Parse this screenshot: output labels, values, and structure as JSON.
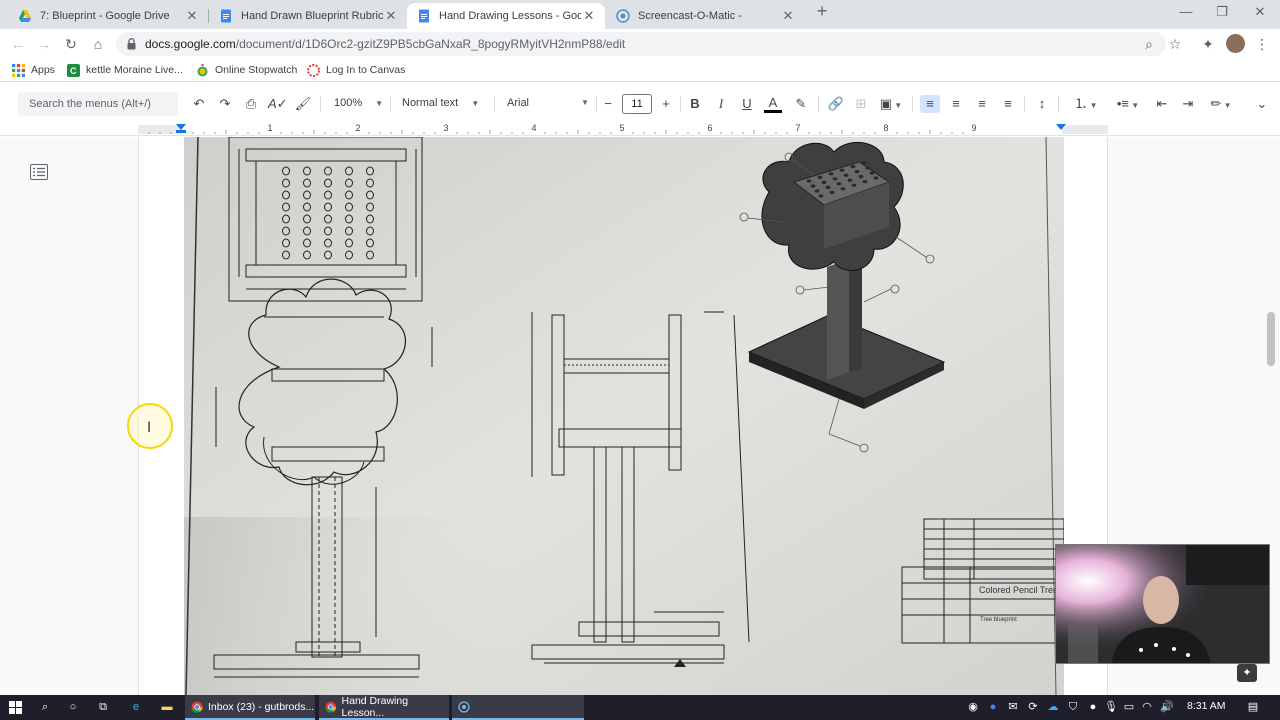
{
  "tabs": [
    {
      "title": "7: Blueprint - Google Drive",
      "icon": "google-drive-icon",
      "active": false
    },
    {
      "title": "Hand Drawn Blueprint Rubric - G",
      "icon": "google-docs-icon",
      "active": false
    },
    {
      "title": "Hand Drawing Lessons - Google",
      "icon": "google-docs-icon",
      "active": true
    },
    {
      "title": "Screencast-O-Matic -",
      "icon": "screencast-icon",
      "active": false
    }
  ],
  "address": {
    "host": "docs.google.com",
    "path": "/document/d/1D6Orc2-gzitZ9PB5cbGaNxaR_8pogyRMyitVH2nmP88/edit"
  },
  "bookmarks": [
    {
      "label": "Apps",
      "icon": "apps-grid-icon"
    },
    {
      "label": "kettle Moraine Live...",
      "icon": "classroom-icon"
    },
    {
      "label": "Online Stopwatch",
      "icon": "stopwatch-icon"
    },
    {
      "label": "Log In to Canvas",
      "icon": "canvas-icon"
    }
  ],
  "toolbar": {
    "search_placeholder": "Search the menus (Alt+/)",
    "zoom": "100%",
    "style": "Normal text",
    "font": "Arial",
    "font_size": "11"
  },
  "ruler": {
    "numbers": [
      "1",
      "2",
      "3",
      "4",
      "5",
      "6",
      "7",
      "8",
      "9"
    ]
  },
  "drawing": {
    "title_block_name": "Colored Pencil Tree",
    "title_block_sub": "Tree blueprint"
  },
  "taskbar": {
    "apps": [
      {
        "label": "Inbox (23) - gutbrods...",
        "icon": "chrome-icon"
      },
      {
        "label": "Hand Drawing Lesson...",
        "icon": "chrome-icon"
      }
    ],
    "time": "8:31 AM"
  },
  "colors": {
    "tab_strip": "#dee1e6",
    "accent_blue": "#1a73e8",
    "taskbar": "#1f1f2b"
  }
}
